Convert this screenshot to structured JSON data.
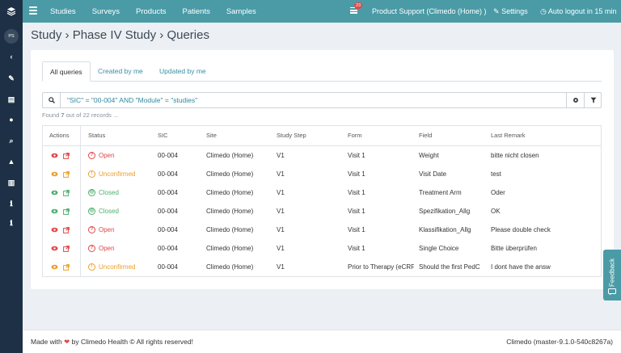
{
  "nav": {
    "items": [
      "Studies",
      "Surveys",
      "Products",
      "Patients",
      "Samples"
    ],
    "notification_count": "23",
    "support": "Product Support (Climedo (Home) )",
    "settings": "Settings",
    "autologout": "Auto logout in 15 min"
  },
  "sidebar": {
    "avatar": "PS"
  },
  "breadcrumb": {
    "a": "Study",
    "b": "Phase IV Study",
    "c": "Queries"
  },
  "tabs": [
    "All queries",
    "Created by me",
    "Updated by me"
  ],
  "search": {
    "query": "\"SIC\" = \"00-004\" AND \"Module\" = \"studies\""
  },
  "found": {
    "pre": "Found ",
    "count": "7",
    "post": " out of 22 records ..."
  },
  "table": {
    "headers": [
      "Actions",
      "Status",
      "SIC",
      "Site",
      "Study Step",
      "Form",
      "Field",
      "Last Remark"
    ],
    "rows": [
      {
        "status": "Open",
        "sic": "00-004",
        "site": "Climedo (Home)",
        "step": "V1",
        "form": "Visit 1",
        "field": "Weight",
        "remark": "bitte nicht closen"
      },
      {
        "status": "Unconfirmed",
        "sic": "00-004",
        "site": "Climedo (Home)",
        "step": "V1",
        "form": "Visit 1",
        "field": "Visit Date",
        "remark": "test"
      },
      {
        "status": "Closed",
        "sic": "00-004",
        "site": "Climedo (Home)",
        "step": "V1",
        "form": "Visit 1",
        "field": "Treatment Arm",
        "remark": "Oder"
      },
      {
        "status": "Closed",
        "sic": "00-004",
        "site": "Climedo (Home)",
        "step": "V1",
        "form": "Visit 1",
        "field": "Spezifikation_Allg",
        "remark": "OK"
      },
      {
        "status": "Open",
        "sic": "00-004",
        "site": "Climedo (Home)",
        "step": "V1",
        "form": "Visit 1",
        "field": "Klassifikation_Allg",
        "remark": "Please double check"
      },
      {
        "status": "Open",
        "sic": "00-004",
        "site": "Climedo (Home)",
        "step": "V1",
        "form": "Visit 1",
        "field": "Single Choice",
        "remark": "Bitte überprüfen"
      },
      {
        "status": "Unconfirmed",
        "sic": "00-004",
        "site": "Climedo (Home)",
        "step": "V1",
        "form": "Prior to Therapy (eCRF)",
        "field": "Should the first PedC",
        "remark": "I dont have the answ"
      }
    ]
  },
  "feedback": "Feedback",
  "footer": {
    "made_with": "Made with",
    "by": "by Climedo Health © All rights reserved!",
    "version": "Climedo (master-9.1.0-540c8267a)"
  },
  "colors": {
    "teal": "#4a9ba6",
    "navy": "#1d3045",
    "open": "#e04848",
    "unconfirmed": "#e9a02a",
    "closed": "#4caf6d"
  }
}
